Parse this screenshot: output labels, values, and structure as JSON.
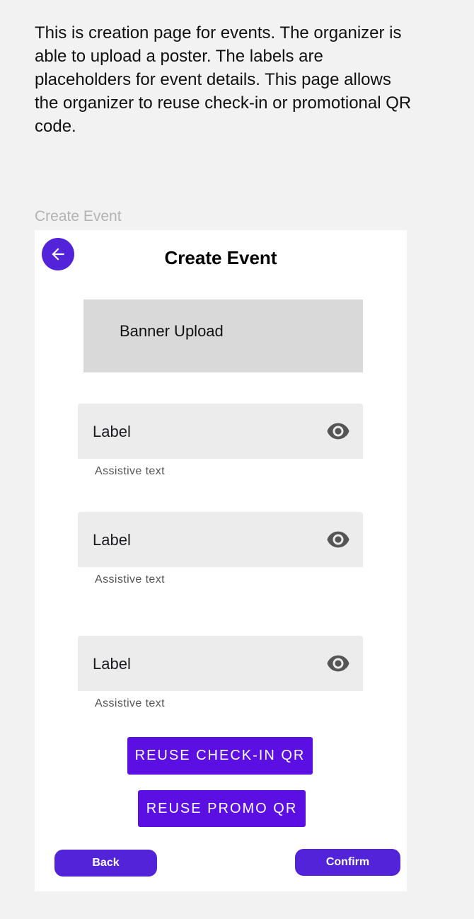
{
  "description": "This is creation page for events. The organizer is able to upload a poster. The labels are placeholders for event details. This page allows the organizer to reuse check-in or promotional QR code.",
  "frame_label": "Create Event",
  "header": {
    "title": "Create Event",
    "back_icon": "arrow-left-icon"
  },
  "banner": {
    "label": "Banner Upload"
  },
  "fields": [
    {
      "label": "Label",
      "assistive": "Assistive text",
      "icon": "eye-icon"
    },
    {
      "label": "Label",
      "assistive": "Assistive text",
      "icon": "eye-icon"
    },
    {
      "label": "Label",
      "assistive": "Assistive text",
      "icon": "eye-icon"
    }
  ],
  "qr_buttons": {
    "checkin_label": "REUSE CHECK-IN QR",
    "promo_label": "REUSE PROMO QR"
  },
  "footer": {
    "back_label": "Back",
    "confirm_label": "Confirm"
  },
  "colors": {
    "accent": "#5223d9",
    "qr_button": "#5b0fe3",
    "field_bg": "#ececec",
    "banner_bg": "#d9d9d9",
    "page_bg": "#f2f2f2"
  }
}
